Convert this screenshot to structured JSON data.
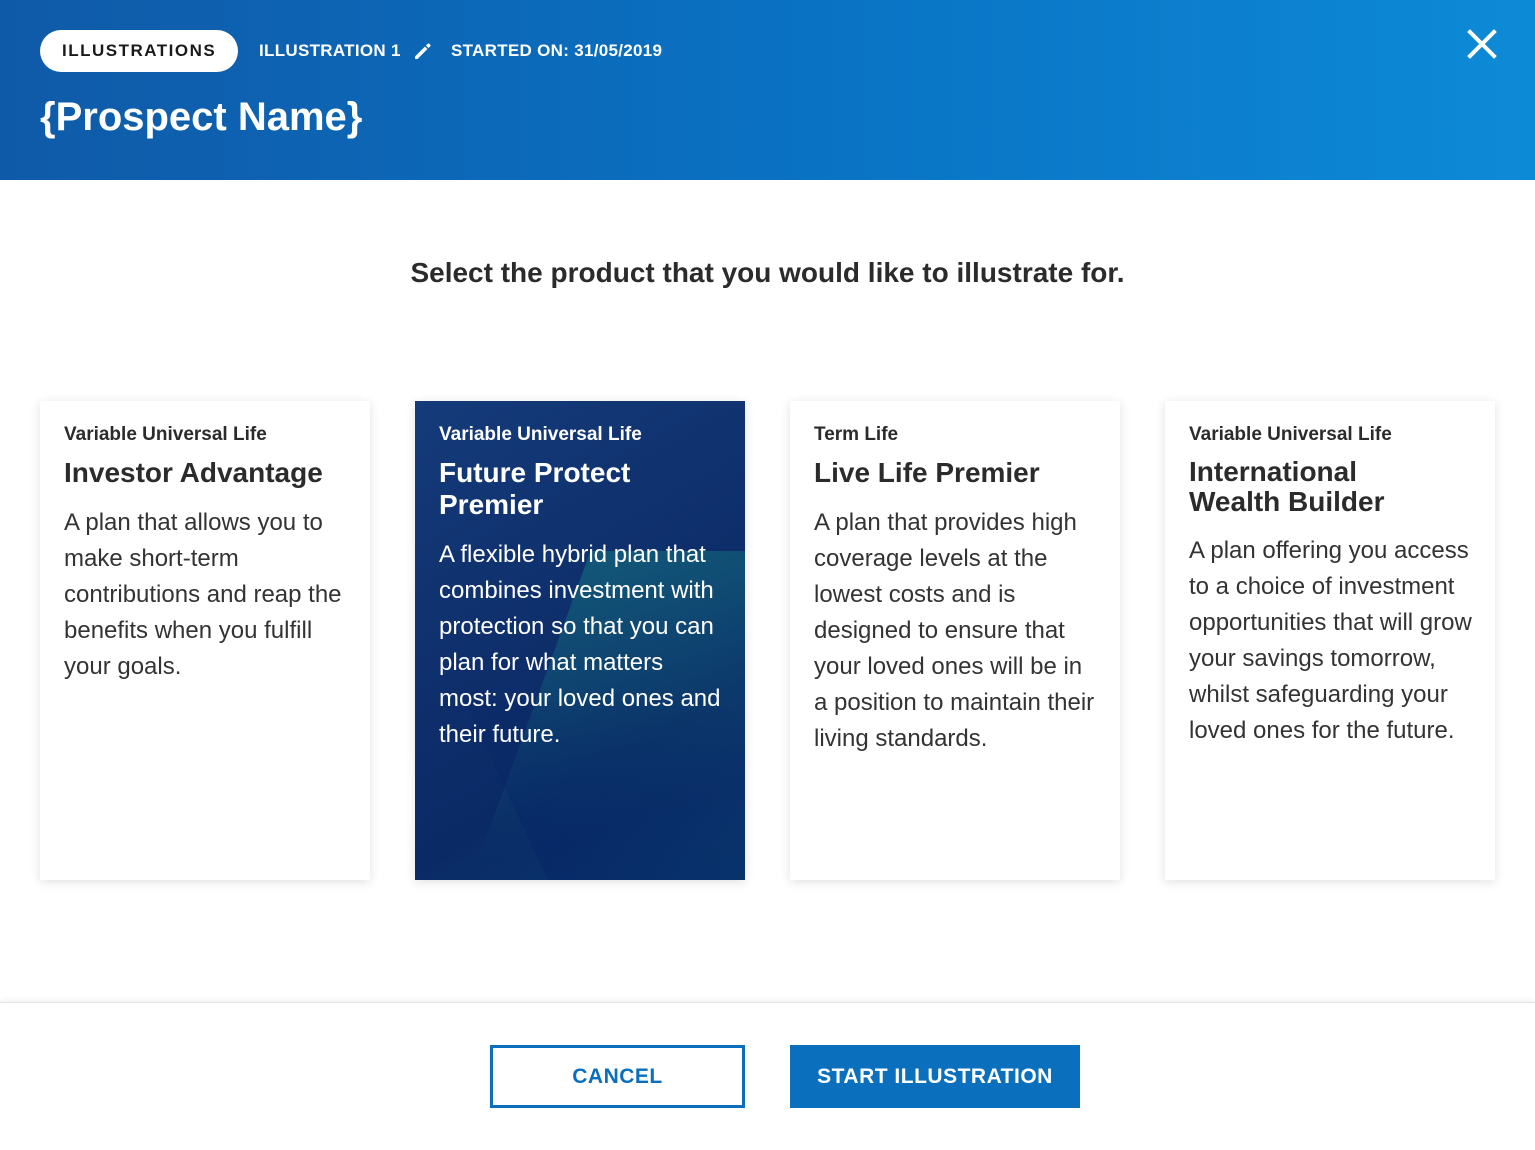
{
  "header": {
    "breadcrumb_root": "ILLUSTRATIONS",
    "illustration_name": "ILLUSTRATION 1",
    "started_on": "STARTED ON: 31/05/2019",
    "prospect_name": "{Prospect Name}",
    "icons": {
      "edit": "pencil-icon",
      "close": "close-icon"
    }
  },
  "main": {
    "prompt": "Select the product that you would like to illustrate for."
  },
  "products": [
    {
      "type": "Variable Universal Life",
      "title": "Investor Advantage",
      "description": "A plan that allows you to make short-term contributions and reap the benefits when you fulfill your goals.",
      "selected": false
    },
    {
      "type": "Variable Universal Life",
      "title": "Future Protect Premier",
      "description": "A flexible hybrid plan that combines investment with protection so that you can plan for what matters most: your loved ones and their future.",
      "selected": true
    },
    {
      "type": "Term Life",
      "title": "Live Life Premier",
      "description": "A plan that provides high coverage levels at the lowest costs and is designed to ensure that your loved ones will be in a position to maintain their living standards.",
      "selected": false
    },
    {
      "type": "Variable Universal Life",
      "title": "International Wealth Builder",
      "description": "A plan offering you access to a choice of investment opportunities that will grow your savings tomorrow, whilst safeguarding your loved ones for the future.",
      "selected": false
    }
  ],
  "footer": {
    "cancel_label": "CANCEL",
    "start_label": "START ILLUSTRATION"
  },
  "colors": {
    "header_start": "#0f5aa8",
    "header_end": "#0d8ad6",
    "primary": "#0a6fbd",
    "selected_card": "#0e2f6b"
  }
}
